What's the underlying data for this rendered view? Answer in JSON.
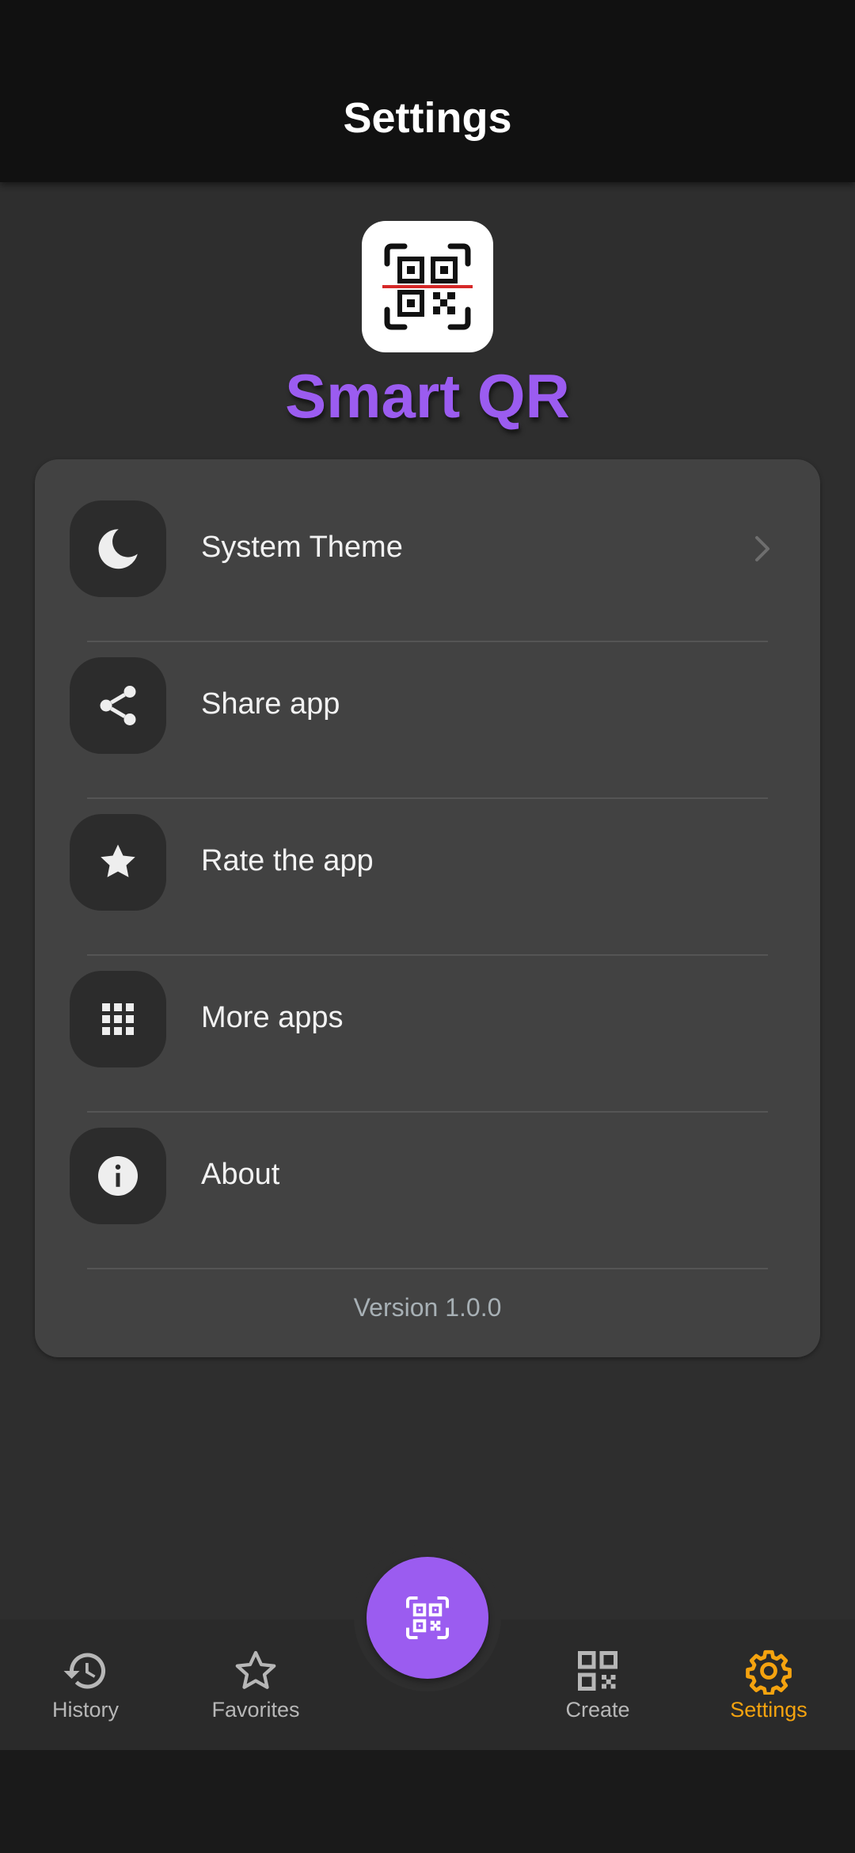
{
  "appbar": {
    "title": "Settings"
  },
  "app": {
    "name": "Smart QR",
    "name_color": "#9b5cf0"
  },
  "settings": {
    "items": [
      {
        "label": "System Theme",
        "icon": "moon-icon",
        "has_chevron": true
      },
      {
        "label": "Share app",
        "icon": "share-icon"
      },
      {
        "label": "Rate the app",
        "icon": "star-icon"
      },
      {
        "label": "More apps",
        "icon": "grid-icon"
      },
      {
        "label": "About",
        "icon": "info-icon"
      }
    ],
    "version": "Version 1.0.0"
  },
  "fab": {
    "icon": "qr-scan-icon",
    "color": "#9b5cf0"
  },
  "nav": {
    "items": [
      {
        "label": "History",
        "icon": "history-icon",
        "active": false
      },
      {
        "label": "Favorites",
        "icon": "star-outline-icon",
        "active": false
      },
      {
        "label": "Create",
        "icon": "qr-code-icon",
        "active": false
      },
      {
        "label": "Settings",
        "icon": "gear-icon",
        "active": true
      }
    ],
    "active_color": "#f5a30f"
  }
}
